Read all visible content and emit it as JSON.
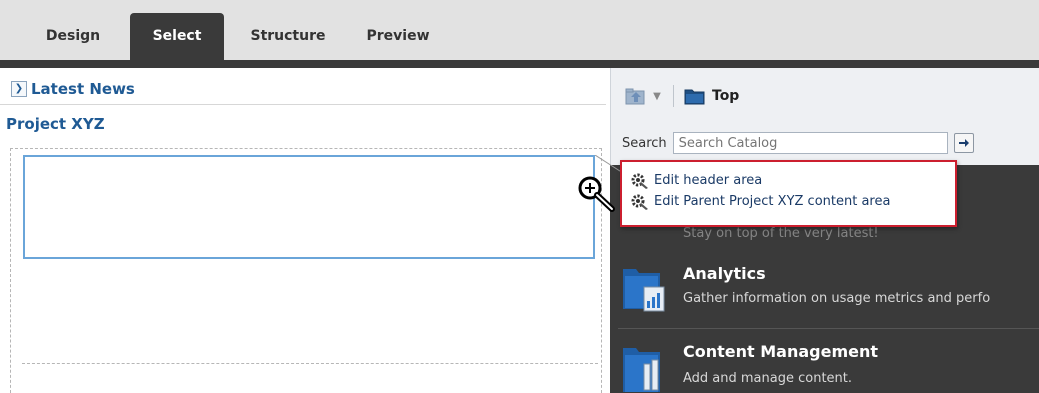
{
  "tabs": [
    {
      "label": "Design",
      "active": false
    },
    {
      "label": "Select",
      "active": true
    },
    {
      "label": "Structure",
      "active": false
    },
    {
      "label": "Preview",
      "active": false
    }
  ],
  "editor": {
    "latest_news_label": "Latest News",
    "project_title": "Project XYZ"
  },
  "catalog": {
    "breadcrumb_label": "Top",
    "search": {
      "label": "Search",
      "placeholder": "Search Catalog"
    },
    "items": [
      {
        "title": "Analytics",
        "description": "Gather information on usage metrics and perfo",
        "icon": "analytics-folder-icon"
      },
      {
        "title": "Content Management",
        "description": "Add and manage content.",
        "icon": "content-folder-icon"
      }
    ],
    "obscured_description": "Stay on top of the very latest!"
  },
  "context_menu": {
    "items": [
      {
        "label": "Edit header area",
        "icon": "gear-edit-icon"
      },
      {
        "label": "Edit Parent Project XYZ content area",
        "icon": "gear-edit-icon"
      }
    ],
    "highlight_color": "#cc1f2f"
  },
  "colors": {
    "accent_blue": "#1f5a94",
    "selection_blue": "#6aa5d9",
    "dark_panel": "#3a3a3a"
  }
}
